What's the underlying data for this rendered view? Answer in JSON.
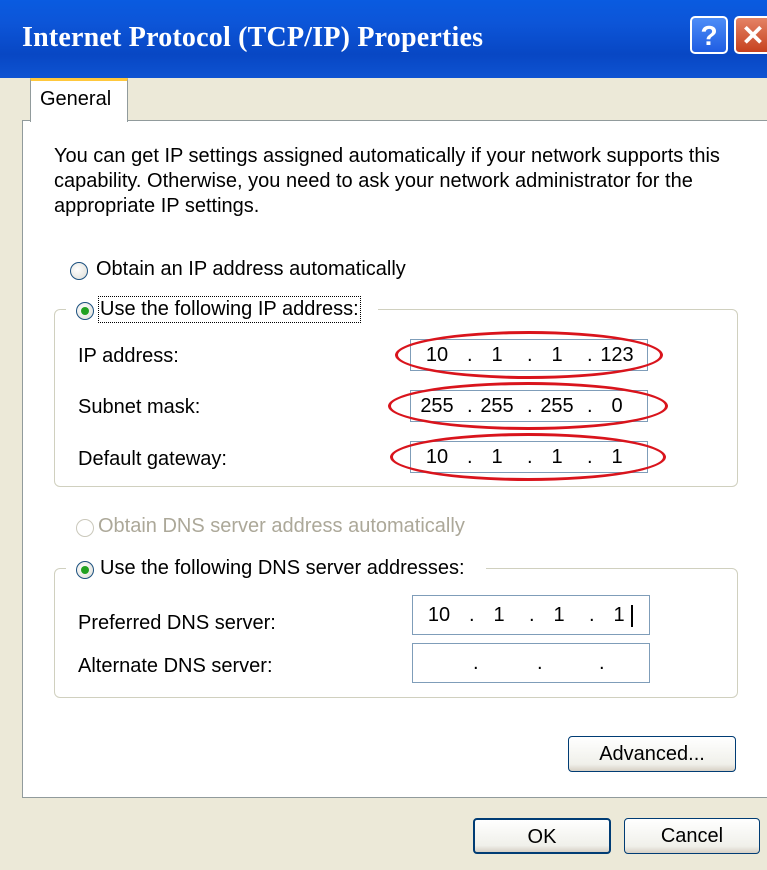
{
  "window": {
    "title": "Internet Protocol (TCP/IP) Properties",
    "help_glyph": "?",
    "close_glyph": "✕"
  },
  "tabs": [
    {
      "label": "General",
      "selected": true
    }
  ],
  "description": "You can get IP settings assigned automatically if your network supports this capability. Otherwise, you need to ask your network administrator for the appropriate IP settings.",
  "ip_mode": {
    "auto_label": "Obtain an IP address automatically",
    "manual_label": "Use the following IP address:",
    "selected": "manual"
  },
  "ip_fields": {
    "ip_address": {
      "label": "IP address:",
      "octets": [
        "10",
        "1",
        "1",
        "123"
      ]
    },
    "subnet_mask": {
      "label": "Subnet mask:",
      "octets": [
        "255",
        "255",
        "255",
        "0"
      ]
    },
    "default_gateway": {
      "label": "Default gateway:",
      "octets": [
        "10",
        "1",
        "1",
        "1"
      ]
    }
  },
  "dns_mode": {
    "auto_label": "Obtain DNS server address automatically",
    "manual_label": "Use the following DNS server addresses:",
    "selected": "manual",
    "auto_disabled": true
  },
  "dns_fields": {
    "preferred": {
      "label": "Preferred DNS server:",
      "octets": [
        "10",
        "1",
        "1",
        "1"
      ]
    },
    "alternate": {
      "label": "Alternate DNS server:",
      "octets": [
        "",
        "",
        "",
        ""
      ]
    }
  },
  "buttons": {
    "advanced": "Advanced...",
    "ok": "OK",
    "cancel": "Cancel"
  },
  "colors": {
    "titlebar": "#0a5be0",
    "dialog_bg": "#ece9d8",
    "annotation": "#d9141c",
    "radio_dot": "#21a121"
  }
}
